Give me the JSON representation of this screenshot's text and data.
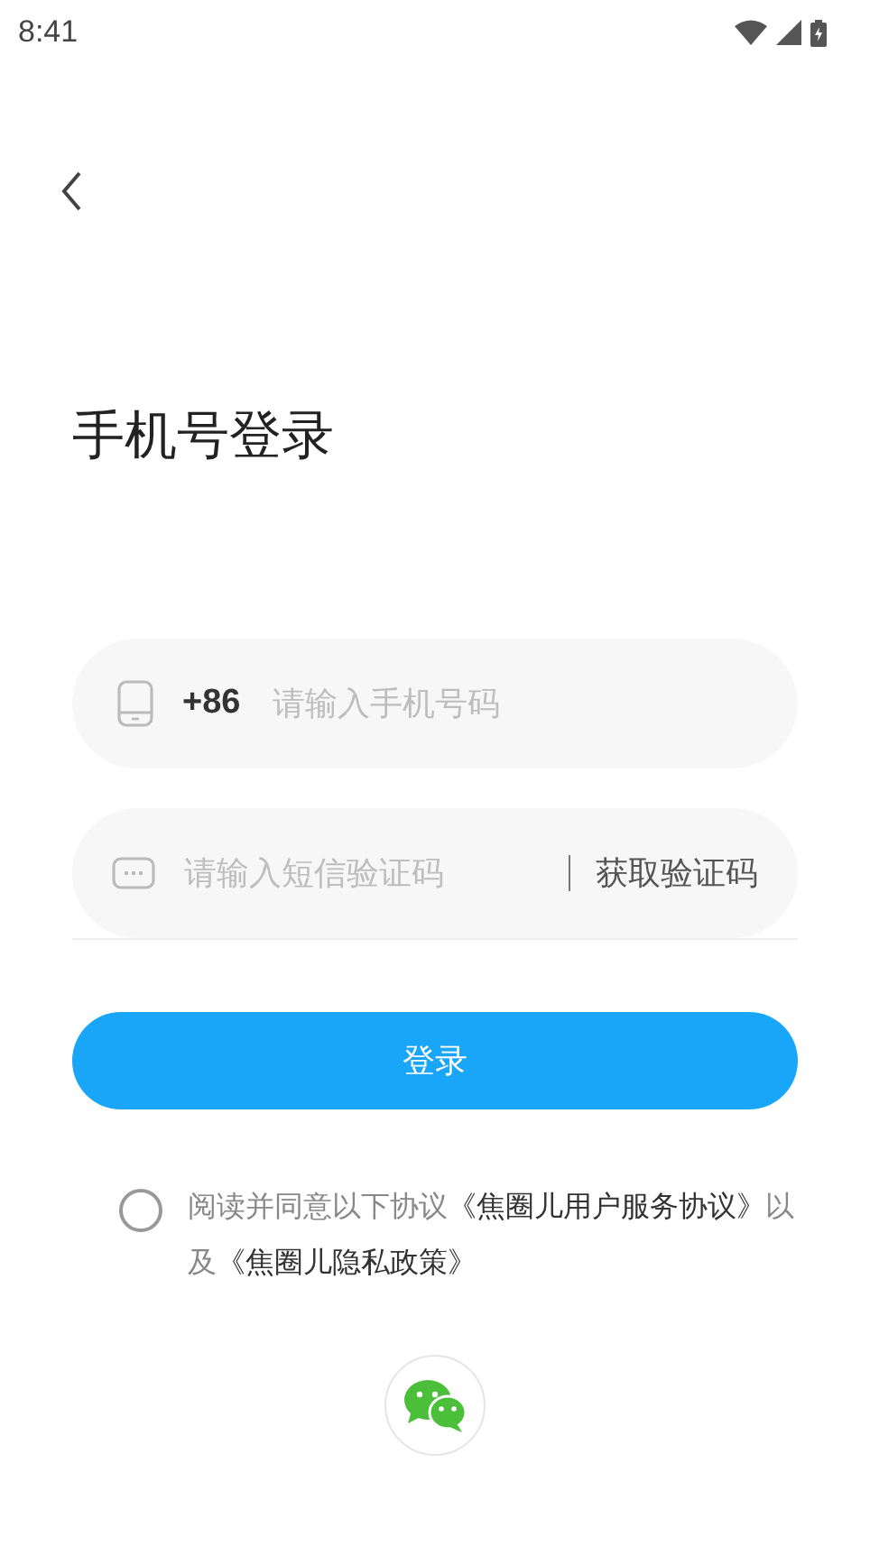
{
  "status_bar": {
    "time": "8:41"
  },
  "title": "手机号登录",
  "phone_field": {
    "country_code": "+86",
    "placeholder": "请输入手机号码"
  },
  "code_field": {
    "placeholder": "请输入短信验证码",
    "action": "获取验证码"
  },
  "login_button": "登录",
  "agreement": {
    "checked": false,
    "segments": [
      {
        "kind": "text",
        "text": "阅读并同意以下协议"
      },
      {
        "kind": "link",
        "text": "《焦圈儿用户服务协议》"
      },
      {
        "kind": "text",
        "text": "以及"
      },
      {
        "kind": "link",
        "text": "《焦圈儿隐私政策》"
      }
    ]
  }
}
